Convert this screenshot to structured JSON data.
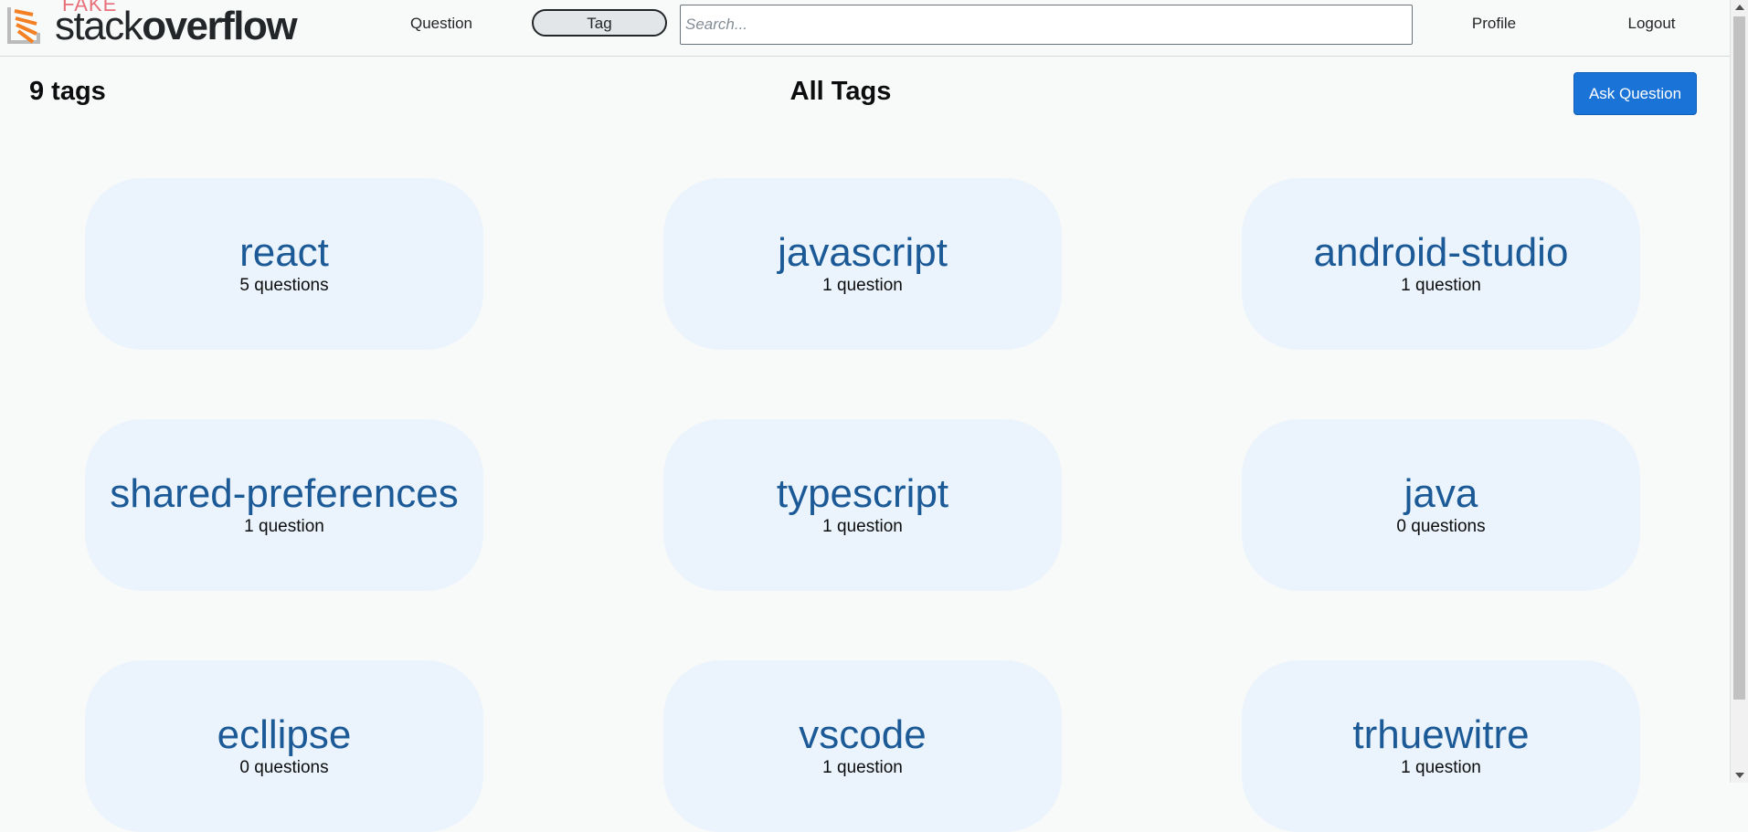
{
  "header": {
    "logo_fake": "FAKE",
    "logo_light": "stack",
    "logo_bold": "overflow",
    "nav_question": "Question",
    "nav_tag": "Tag",
    "search_placeholder": "Search...",
    "nav_profile": "Profile",
    "nav_logout": "Logout"
  },
  "page": {
    "tag_count": "9 tags",
    "title": "All Tags",
    "ask_button": "Ask Question"
  },
  "tags": [
    {
      "name": "react",
      "questions": "5 questions"
    },
    {
      "name": "javascript",
      "questions": "1 question"
    },
    {
      "name": "android-studio",
      "questions": "1 question"
    },
    {
      "name": "shared-preferences",
      "questions": "1 question"
    },
    {
      "name": "typescript",
      "questions": "1 question"
    },
    {
      "name": "java",
      "questions": "0 questions"
    },
    {
      "name": "ecllipse",
      "questions": "0 questions"
    },
    {
      "name": "vscode",
      "questions": "1 question"
    },
    {
      "name": "trhuewitre",
      "questions": "1 question"
    }
  ],
  "colors": {
    "accent": "#1a73d6",
    "tag_link": "#1b5a97",
    "card_bg": "#ebf4fc",
    "logo_orange": "#f48024"
  }
}
